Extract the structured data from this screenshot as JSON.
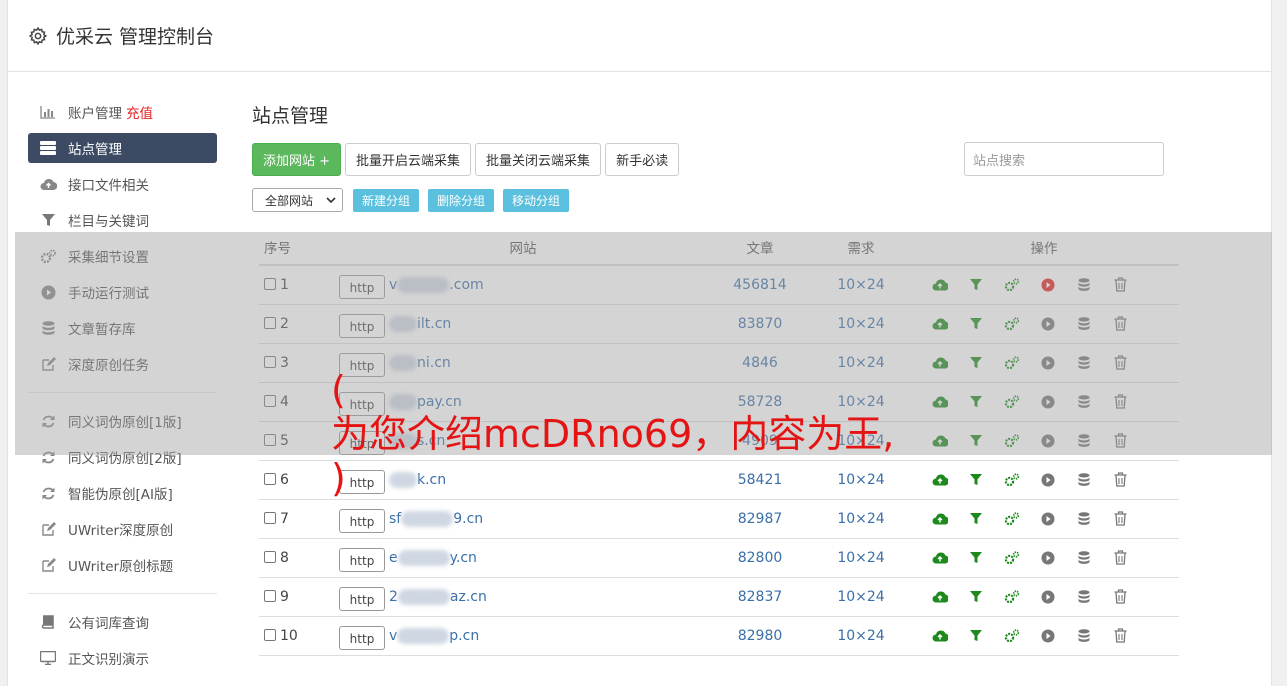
{
  "app": {
    "title": "优采云 管理控制台"
  },
  "sidebar": {
    "groups": [
      [
        {
          "label": "账户管理",
          "badge": "充值",
          "icon": "bar-chart-icon"
        },
        {
          "label": "站点管理",
          "icon": "server-icon",
          "active": true
        },
        {
          "label": "接口文件相关",
          "icon": "cloud-upload-icon"
        },
        {
          "label": "栏目与关键词",
          "icon": "filter-icon"
        },
        {
          "label": "采集细节设置",
          "icon": "gears-icon"
        },
        {
          "label": "手动运行测试",
          "icon": "play-circle-icon"
        },
        {
          "label": "文章暂存库",
          "icon": "database-icon"
        },
        {
          "label": "深度原创任务",
          "icon": "edit-icon"
        }
      ],
      [
        {
          "label": "同义词伪原创[1版]",
          "icon": "refresh-icon"
        },
        {
          "label": "同义词伪原创[2版]",
          "icon": "refresh-icon"
        },
        {
          "label": "智能伪原创[AI版]",
          "icon": "refresh-icon"
        },
        {
          "label": "UWriter深度原创",
          "icon": "edit-icon"
        },
        {
          "label": "UWriter原创标题",
          "icon": "edit-icon"
        }
      ],
      [
        {
          "label": "公有词库查询",
          "icon": "book-icon"
        },
        {
          "label": "正文识别演示",
          "icon": "desktop-icon"
        }
      ]
    ]
  },
  "main": {
    "title": "站点管理",
    "toolbar": {
      "add_label": "添加网站 +",
      "batch_open_label": "批量开启云端采集",
      "batch_close_label": "批量关闭云端采集",
      "guide_label": "新手必读"
    },
    "search": {
      "placeholder": "站点搜索"
    },
    "group_select": {
      "value": "全部网站"
    },
    "group_buttons": {
      "new": "新建分组",
      "delete": "删除分组",
      "move": "移动分组"
    },
    "table": {
      "headers": {
        "no": "序号",
        "site": "网站",
        "articles": "文章",
        "demand": "需求",
        "ops": "操作"
      },
      "rows": [
        {
          "no": "1",
          "proto": "http",
          "prefix": "v",
          "suffix": ".com",
          "articles": "456814",
          "demand": "10×24",
          "running": true
        },
        {
          "no": "2",
          "proto": "http",
          "prefix": "",
          "suffix": "ilt.cn",
          "articles": "83870",
          "demand": "10×24",
          "running": false
        },
        {
          "no": "3",
          "proto": "http",
          "prefix": "",
          "suffix": "ni.cn",
          "articles": "4846",
          "demand": "10×24",
          "running": false
        },
        {
          "no": "4",
          "proto": "http",
          "prefix": "",
          "suffix": "pay.cn",
          "articles": "58728",
          "demand": "10×24",
          "running": false
        },
        {
          "no": "5",
          "proto": "http",
          "prefix": "",
          "suffix": "s.cn",
          "articles": "4909",
          "demand": "10×24",
          "running": false
        },
        {
          "no": "6",
          "proto": "http",
          "prefix": "",
          "suffix": "k.cn",
          "articles": "58421",
          "demand": "10×24",
          "running": false
        },
        {
          "no": "7",
          "proto": "http",
          "prefix": "sf",
          "suffix": "9.cn",
          "articles": "82987",
          "demand": "10×24",
          "running": false
        },
        {
          "no": "8",
          "proto": "http",
          "prefix": "e",
          "suffix": "y.cn",
          "articles": "82800",
          "demand": "10×24",
          "running": false
        },
        {
          "no": "9",
          "proto": "http",
          "prefix": "2",
          "suffix": "az.cn",
          "articles": "82837",
          "demand": "10×24",
          "running": false
        },
        {
          "no": "10",
          "proto": "http",
          "prefix": "v",
          "suffix": "p.cn",
          "articles": "82980",
          "demand": "10×24",
          "running": false
        }
      ]
    }
  },
  "watermark": {
    "lines": [
      "(",
      "为您介绍mcDRno69，内容为王,",
      ")"
    ]
  },
  "colors": {
    "accent_green": "#5cb85c",
    "info": "#5bc0de",
    "sidebar_active": "#3c4a63",
    "link": "#3a6fa8",
    "danger": "#e52222",
    "icon_green": "#1e8a1e"
  }
}
